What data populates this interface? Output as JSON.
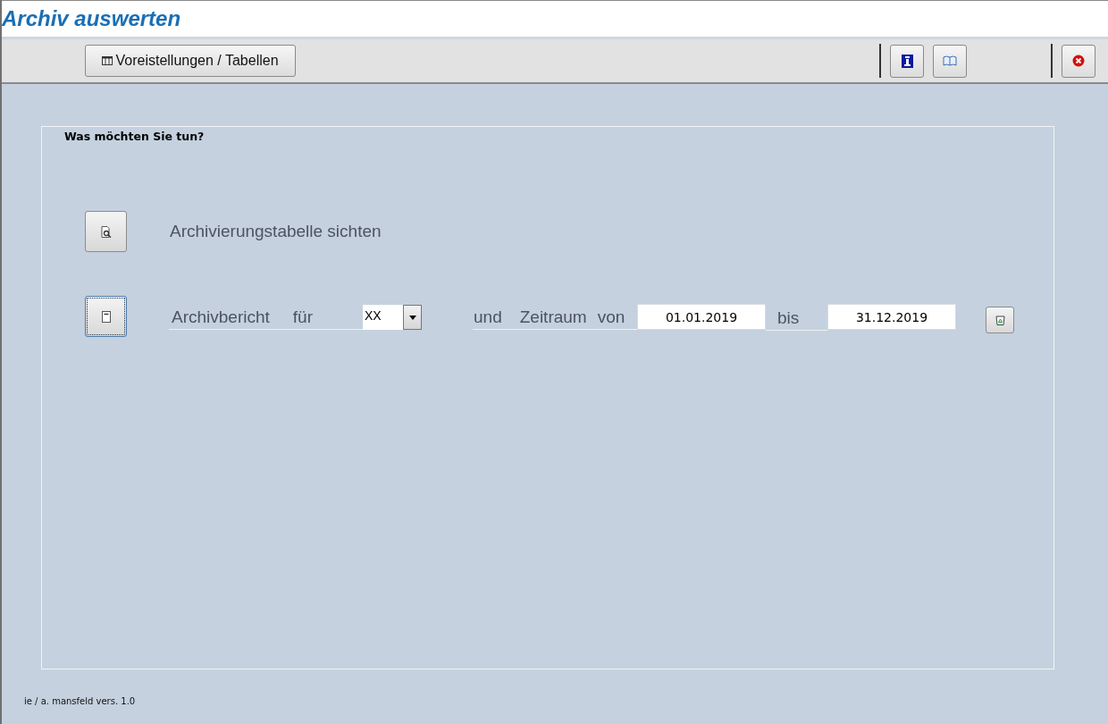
{
  "window": {
    "title": "Archiv auswerten"
  },
  "toolbar": {
    "settings_button": "Voreistellungen / Tabellen"
  },
  "panel": {
    "heading": "Was möchten Sie tun?",
    "actions": [
      {
        "kind": "view",
        "label": "Archivierungstabelle sichten",
        "focused": false
      },
      {
        "kind": "report",
        "focused": true,
        "label": "Archivbericht",
        "for_label": "für",
        "combo_value": "XX",
        "and_label": "und",
        "period_label": "Zeitraum",
        "from_label": "von",
        "from_value": "01.01.2019",
        "to_label": "bis",
        "to_value": "31.12.2019"
      }
    ]
  },
  "footer": "ie / a. mansfeld vers. 1.0"
}
